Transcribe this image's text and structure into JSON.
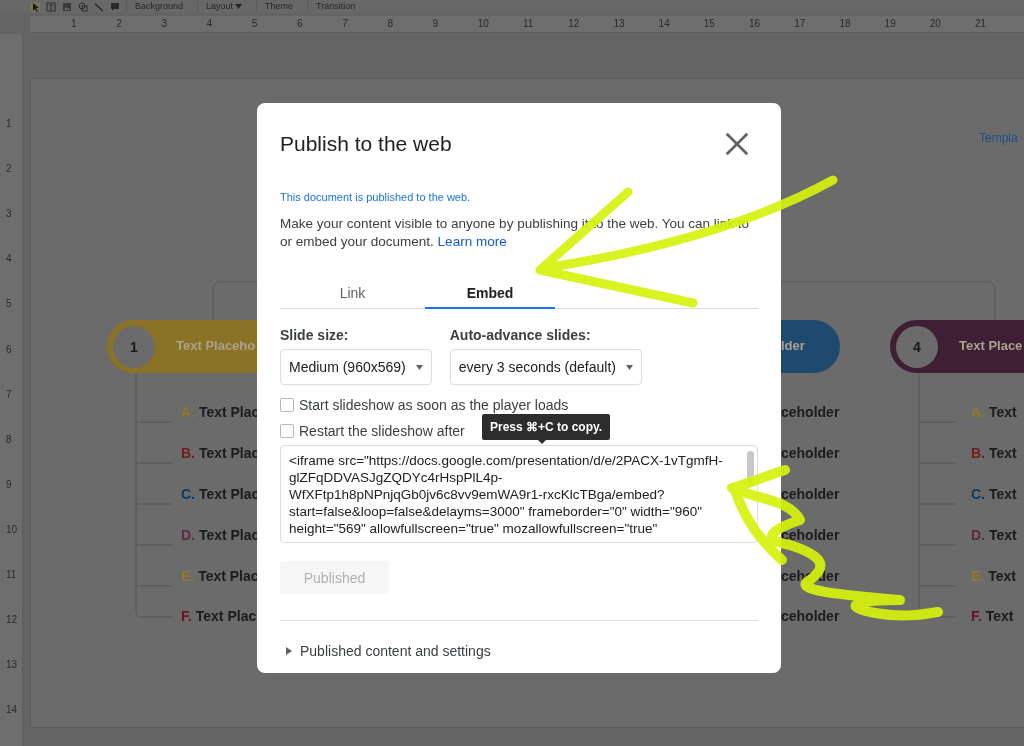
{
  "toolbar": {
    "items": [
      {
        "label": "Background",
        "kind": "button"
      },
      {
        "label": "Layout",
        "kind": "menu"
      },
      {
        "label": "Theme",
        "kind": "button"
      },
      {
        "label": "Transition",
        "kind": "button"
      }
    ]
  },
  "ruler": {
    "horizontal": [
      "1",
      "2",
      "3",
      "4",
      "5",
      "6",
      "7",
      "8",
      "9",
      "10",
      "11",
      "12",
      "13",
      "14",
      "15",
      "16",
      "17",
      "18",
      "19",
      "20",
      "21"
    ],
    "vertical": [
      "1",
      "2",
      "3",
      "4",
      "5",
      "6",
      "7",
      "8",
      "9",
      "10",
      "11",
      "12",
      "13",
      "14"
    ]
  },
  "slide": {
    "brand": "Templa",
    "columns": [
      {
        "number": "1",
        "title": "Text Placeho",
        "color": "#8a7226",
        "items": [
          {
            "letter": "A.",
            "text": "Text Plac",
            "color": "#8f7a2a"
          },
          {
            "letter": "B.",
            "text": "Text Plac",
            "color": "#6e1c1c"
          },
          {
            "letter": "C.",
            "text": "Text Plac",
            "color": "#0e3a66"
          },
          {
            "letter": "D.",
            "text": "Text Plac",
            "color": "#5c2c44"
          },
          {
            "letter": "E.",
            "text": "Text Plac",
            "color": "#8f7a2a"
          },
          {
            "letter": "F.",
            "text": "Text Plac",
            "color": "#6a1426"
          }
        ]
      },
      {
        "title": "lder",
        "color": "#1f4a70",
        "items": [
          {
            "text": "ceholder"
          },
          {
            "text": "ceholder"
          },
          {
            "text": "ceholder"
          },
          {
            "text": "ceholder"
          },
          {
            "text": "ceholder"
          },
          {
            "text": "ceholder"
          }
        ]
      },
      {
        "number": "4",
        "title": "Text Place",
        "color": "#3e1f36",
        "items": [
          {
            "letter": "A.",
            "text": "Text",
            "color": "#8f7a2a"
          },
          {
            "letter": "B.",
            "text": "Text",
            "color": "#6e1c1c"
          },
          {
            "letter": "C.",
            "text": "Text",
            "color": "#0e3a66"
          },
          {
            "letter": "D.",
            "text": "Text",
            "color": "#5c2c44"
          },
          {
            "letter": "E.",
            "text": "Text",
            "color": "#8f7a2a"
          },
          {
            "letter": "F.",
            "text": "Text",
            "color": "#6a1426"
          }
        ]
      }
    ]
  },
  "dialog": {
    "title": "Publish to the web",
    "status": "This document is published to the web.",
    "description": "Make your content visible to anyone by publishing it to the web. You can link to or embed your document.",
    "link": "Learn more",
    "tabs": [
      {
        "label": "Link",
        "selected": false
      },
      {
        "label": "Embed",
        "selected": true
      }
    ],
    "settings": [
      {
        "label": "Slide size:",
        "value": "Medium (960x569)"
      },
      {
        "label": "Auto-advance slides:",
        "value": "every 3 seconds (default)"
      }
    ],
    "options": [
      {
        "label": "Start slideshow as soon as the player loads",
        "checked": false
      },
      {
        "label": "Restart the slideshow after",
        "checked": false
      }
    ],
    "tooltip": "Press ⌘+C to copy.",
    "embed_code": "<iframe src=\"https://docs.google.com/presentation/d/e/2PACX-1vTgmfH-glZFqDDVASJgZQDYc4rHspPlL4p-WfXFtp1h8pNPnjqGb0jv6c8vv9emWA9r1-rxcKlcTBga/embed?start=false&loop=false&delayms=3000\" frameborder=\"0\" width=\"960\" height=\"569\" allowfullscreen=\"true\" mozallowfullscreen=\"true\"",
    "publish_button": {
      "label": "Published",
      "disabled": true
    },
    "details": {
      "label": "Published content and settings",
      "expanded": false
    }
  }
}
